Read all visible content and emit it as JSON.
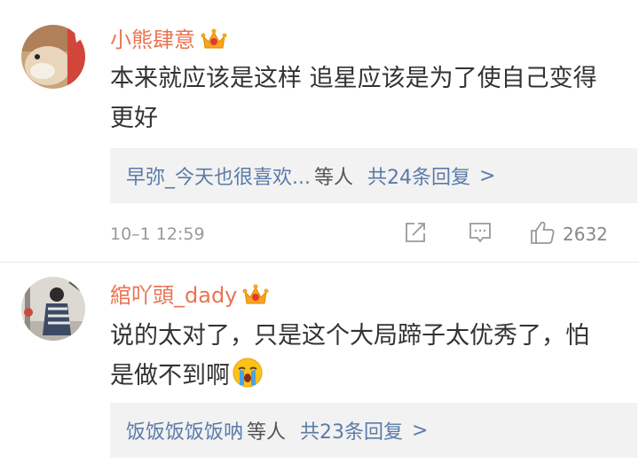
{
  "comments": [
    {
      "username": "小熊肆意",
      "text": "本来就应该是这样 追星应该是为了使自己变得更好",
      "replies": {
        "names": "早弥_今天也很喜欢...",
        "suffix": "等人",
        "count_label": "共24条回复",
        "chevron": ">"
      },
      "timestamp": "10–1 12:59",
      "like_count": "2632",
      "icons": [
        "vip-crown-icon",
        "share-icon",
        "comment-icon",
        "thumbs-up-icon"
      ]
    },
    {
      "username": "綰吖頭_dady",
      "text": "说的太对了，只是这个大局蹄子太优秀了，怕是做不到啊",
      "emoji": "crying-face-emoji",
      "replies": {
        "names": "饭饭饭饭饭呐",
        "suffix": "等人",
        "count_label": "共23条回复",
        "chevron": ">"
      }
    }
  ],
  "colors": {
    "username": "#eb7350",
    "link": "#5b7ba8",
    "reply_bg": "#f2f2f2",
    "meta": "#999999"
  }
}
